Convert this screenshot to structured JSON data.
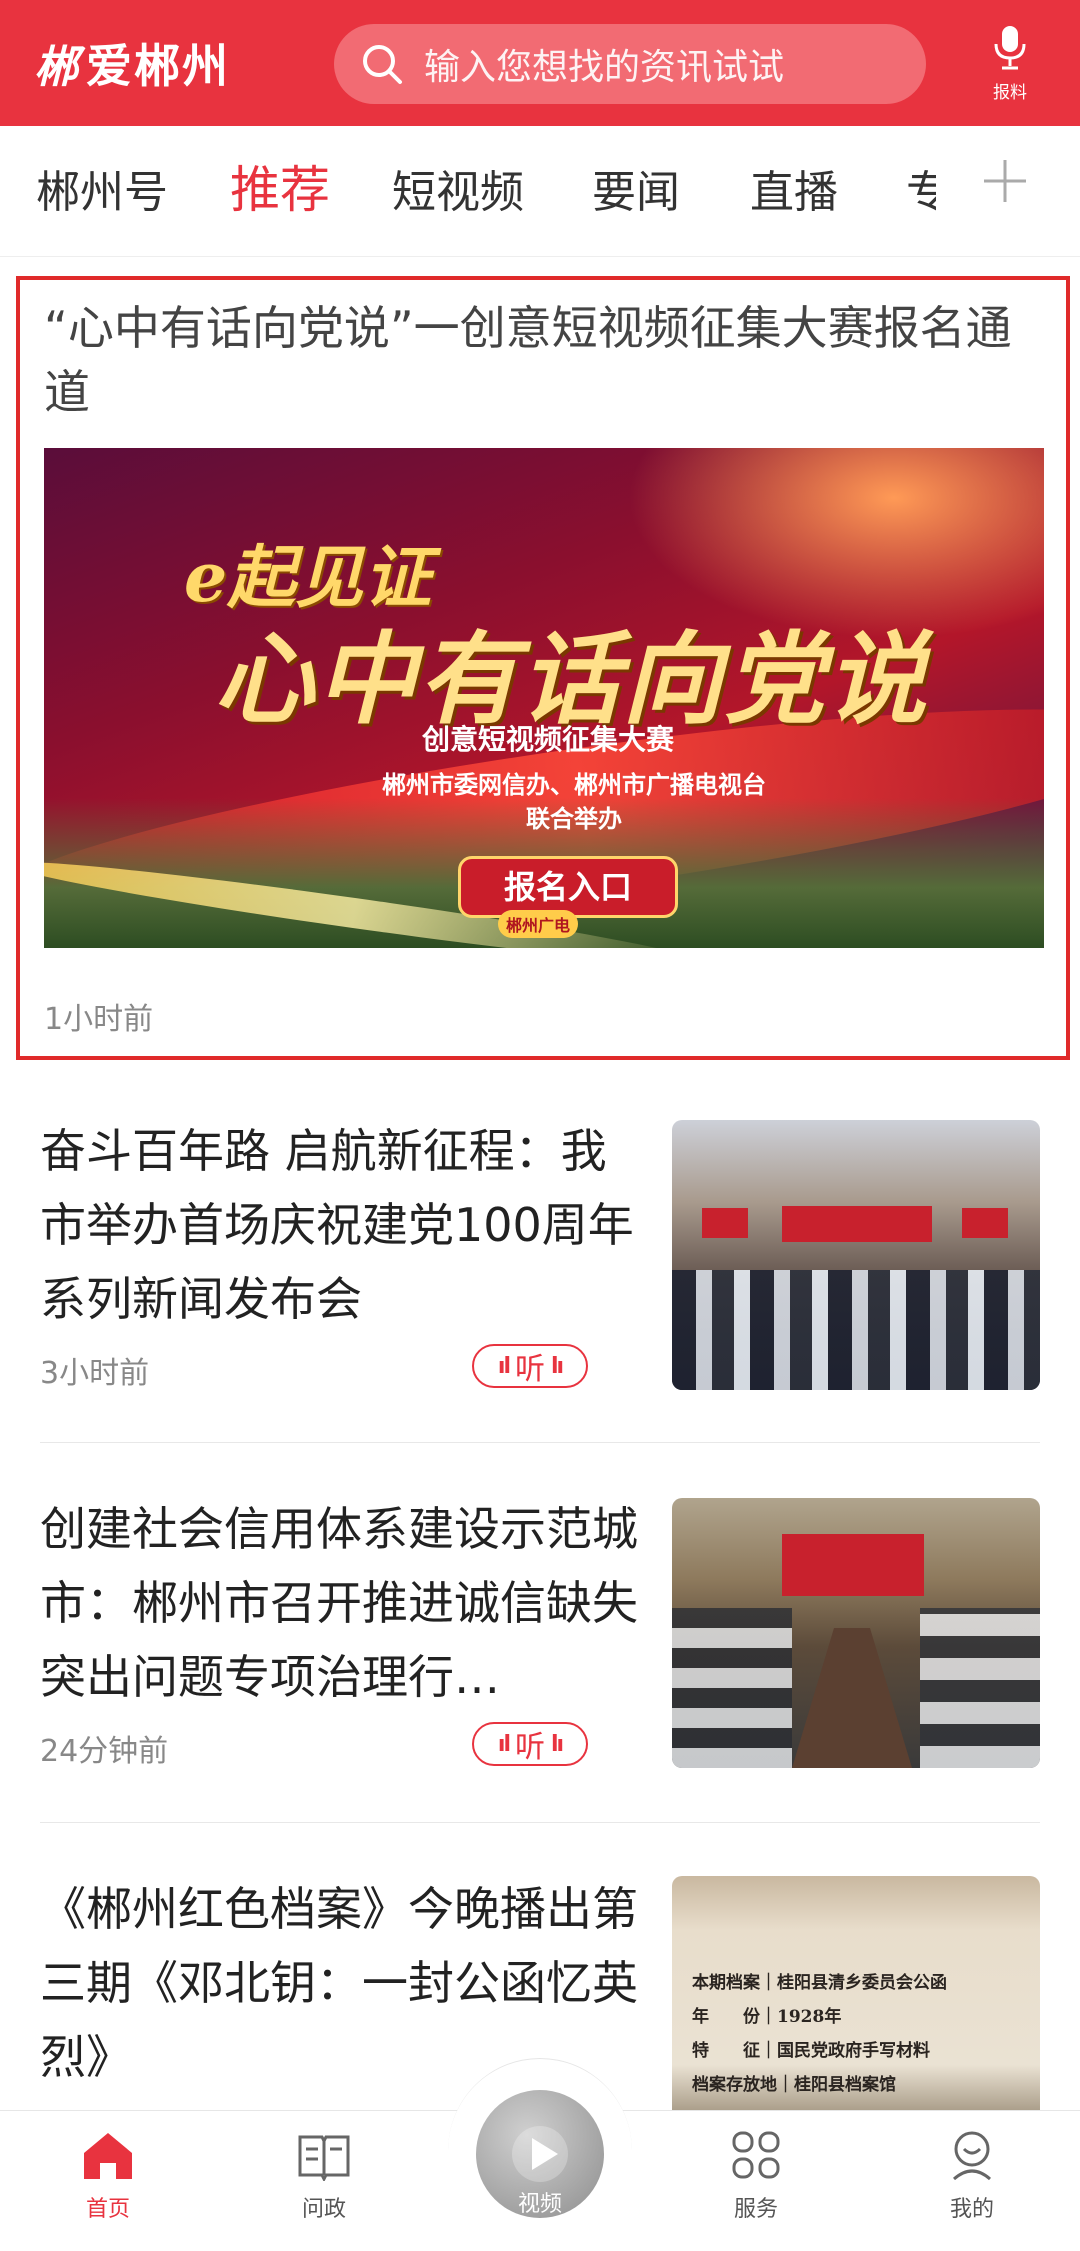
{
  "header": {
    "logo_mark": "郴",
    "logo_text": "爱郴州",
    "search_placeholder": "输入您想找的资讯试试",
    "report_label": "报料"
  },
  "tabs": [
    {
      "label": "郴州号"
    },
    {
      "label": "推荐",
      "active": true
    },
    {
      "label": "短视频"
    },
    {
      "label": "要闻"
    },
    {
      "label": "直播"
    },
    {
      "label": "专"
    }
  ],
  "featured": {
    "title": "“心中有话向党说”一创意短视频征集大赛报名通道",
    "banner": {
      "line1": "e起见证",
      "line2": "心中有话向党说",
      "line3": "创意短视频征集大赛",
      "line4": "郴州市委网信办、郴州市广播电视台",
      "line5": "联合举办",
      "button": "报名入口",
      "badge": "郴州广电"
    },
    "time": "1小时前"
  },
  "news": [
    {
      "title": "奋斗百年路 启航新征程：我市举办首场庆祝建党100周年系列新闻发布会",
      "time": "3小时前",
      "listen": "听"
    },
    {
      "title": "创建社会信用体系建设示范城市：郴州市召开推进诚信缺失突出问题专项治理行…",
      "time": "24分钟前",
      "listen": "听"
    },
    {
      "title": "《郴州红色档案》今晚播出第三期《邓北钥：一封公函忆英烈》",
      "doc_lines": [
        "本期档案｜桂阳县清乡委员会公函",
        "年　　份｜1928年",
        "特　　征｜国民党政府手写材料",
        "档案存放地｜桂阳县档案馆"
      ]
    }
  ],
  "bottom_nav": {
    "home": "首页",
    "politics": "问政",
    "video": "视频",
    "services": "服务",
    "mine": "我的"
  },
  "colors": {
    "brand": "#e8333f",
    "highlight_border": "#e02a2a"
  }
}
